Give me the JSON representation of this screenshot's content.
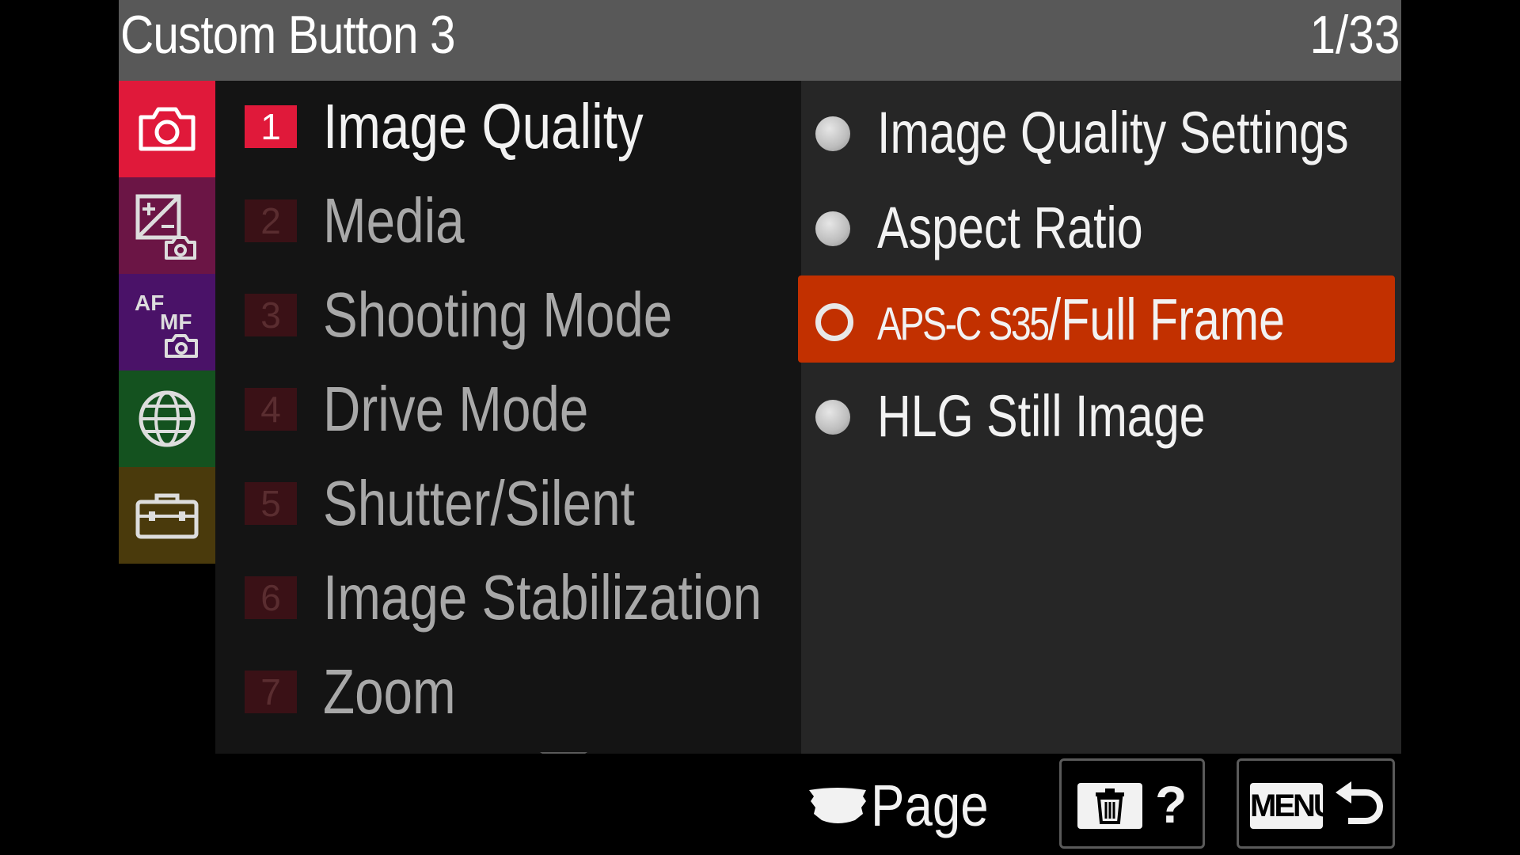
{
  "header": {
    "title": "Custom Button 3",
    "page_indicator": "1/33"
  },
  "categories": [
    {
      "icon": "camera-icon",
      "color": "#e0193a",
      "active": true
    },
    {
      "icon": "exposure-camera-icon",
      "color": "#6b1545"
    },
    {
      "icon": "af-mf-camera-icon",
      "color": "#4a1268"
    },
    {
      "icon": "network-globe-icon",
      "color": "#14521f"
    },
    {
      "icon": "toolbox-icon",
      "color": "#4a3a0c"
    }
  ],
  "menu": {
    "items": [
      {
        "num": "1",
        "label": "Image Quality",
        "active": true
      },
      {
        "num": "2",
        "label": "Media"
      },
      {
        "num": "3",
        "label": "Shooting Mode"
      },
      {
        "num": "4",
        "label": "Drive Mode"
      },
      {
        "num": "5",
        "label": "Shutter/Silent"
      },
      {
        "num": "6",
        "label": "Image Stabilization"
      },
      {
        "num": "7",
        "label": "Zoom"
      }
    ]
  },
  "options": {
    "items": [
      {
        "label": "Image Quality Settings"
      },
      {
        "label": "Aspect Ratio"
      },
      {
        "label_prefix": "APS-C S35",
        "label": "/Full Frame",
        "selected": true
      },
      {
        "label": "HLG Still Image"
      }
    ],
    "selected_color": "#c23000"
  },
  "footer": {
    "page_label": "Page",
    "help_label": "?",
    "menu_label": "MENU"
  }
}
